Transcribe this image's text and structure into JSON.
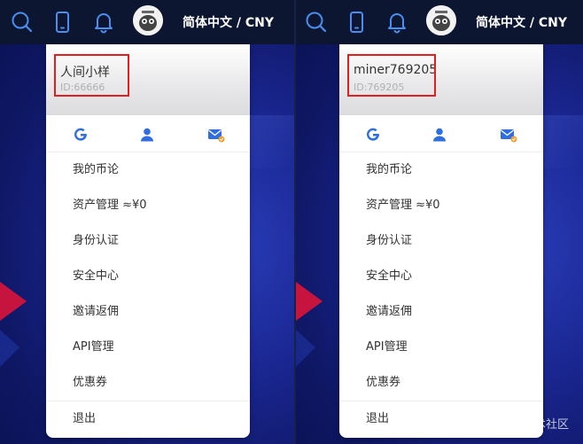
{
  "topbar": {
    "lang_label": "简体中文 / CNY"
  },
  "left_menu": {
    "username": "人间小样",
    "user_id": "ID:66666",
    "items": [
      {
        "label": "我的币论"
      },
      {
        "label": "资产管理 ≈¥0"
      },
      {
        "label": "身份认证"
      },
      {
        "label": "安全中心"
      },
      {
        "label": "邀请返佣"
      },
      {
        "label": "API管理"
      },
      {
        "label": "优惠券"
      }
    ],
    "logout_label": "退出"
  },
  "right_menu": {
    "username": "miner769205",
    "user_id": "ID:769205",
    "items": [
      {
        "label": "我的币论"
      },
      {
        "label": "资产管理 ≈¥0"
      },
      {
        "label": "身份认证"
      },
      {
        "label": "安全中心"
      },
      {
        "label": "邀请返佣"
      },
      {
        "label": "API管理"
      },
      {
        "label": "优惠券"
      }
    ],
    "logout_label": "退出"
  },
  "icons": [
    "search-icon",
    "phone-icon",
    "bell-icon",
    "google-icon",
    "user-icon",
    "mail-icon"
  ],
  "colors": {
    "accent_blue": "#2f6ee0",
    "topbar": "#0c1631",
    "highlight_box": "#e02020"
  },
  "watermark": "@稀土掘金技术社区"
}
